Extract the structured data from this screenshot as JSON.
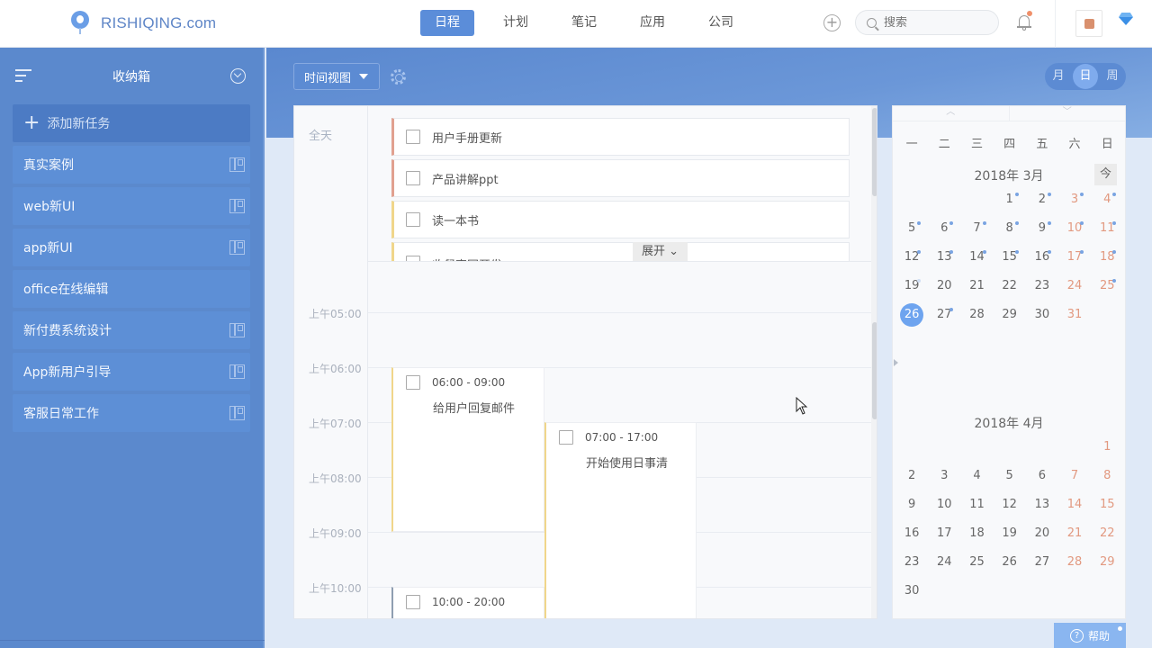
{
  "header": {
    "logo_text": "RISHIQING.com",
    "nav": [
      {
        "label": "日程",
        "active": true
      },
      {
        "label": "计划",
        "active": false
      },
      {
        "label": "笔记",
        "active": false
      },
      {
        "label": "应用",
        "active": false
      },
      {
        "label": "公司",
        "active": false
      }
    ],
    "search_placeholder": "搜索",
    "icons": [
      "plus-circle-icon",
      "search-icon",
      "bell-icon",
      "avatar",
      "diamond-icon"
    ],
    "notification_dot_color": "#f0906a"
  },
  "sidebar": {
    "title": "收纳箱",
    "add_task_label": "添加新任务",
    "items": [
      {
        "label": "真实案例",
        "board_icon": true
      },
      {
        "label": "web新UI",
        "board_icon": true
      },
      {
        "label": "app新UI",
        "board_icon": true
      },
      {
        "label": "office在线编辑",
        "board_icon": false
      },
      {
        "label": "新付费系统设计",
        "board_icon": true
      },
      {
        "label": "App新用户引导",
        "board_icon": true
      },
      {
        "label": "客服日常工作",
        "board_icon": true
      }
    ],
    "background_color": "#5b89cd"
  },
  "toolbar": {
    "view_select": "时间视图",
    "modes": [
      {
        "label": "月",
        "active": false
      },
      {
        "label": "日",
        "active": true
      },
      {
        "label": "周",
        "active": false
      }
    ]
  },
  "day_view": {
    "allday_label": "全天",
    "allday_tasks": [
      {
        "title": "用户手册更新",
        "color": "#e1a190"
      },
      {
        "title": "产品讲解ppt",
        "color": "#e1a190"
      },
      {
        "title": "读一本书",
        "color": "#f0d68a"
      },
      {
        "title": "收餐官网开发",
        "color": "#f0d68a"
      }
    ],
    "expand_label": "展开",
    "hour_labels": [
      "上午05:00",
      "上午06:00",
      "上午07:00",
      "上午08:00",
      "上午09:00",
      "上午10:00"
    ],
    "events": [
      {
        "time": "06:00 - 09:00",
        "title": "给用户回复邮件"
      },
      {
        "time": "07:00 - 17:00",
        "title": "开始使用日事清"
      },
      {
        "time": "10:00 - 20:00",
        "title": ""
      }
    ]
  },
  "mini_calendar": {
    "weekdays": [
      "一",
      "二",
      "三",
      "四",
      "五",
      "六",
      "日"
    ],
    "today_label": "今",
    "months": [
      {
        "title": "2018年 3月",
        "offset": 3,
        "days": 31,
        "today": 26,
        "dots": [
          1,
          2,
          3,
          4,
          5,
          6,
          7,
          8,
          9,
          10,
          11,
          12,
          13,
          14,
          15,
          16,
          17,
          18,
          25,
          27
        ],
        "faint_dots": [
          19
        ]
      },
      {
        "title": "2018年 4月",
        "offset": 6,
        "days": 30,
        "today": null,
        "dots": [],
        "faint_dots": []
      }
    ]
  },
  "help": {
    "label": "帮助"
  }
}
